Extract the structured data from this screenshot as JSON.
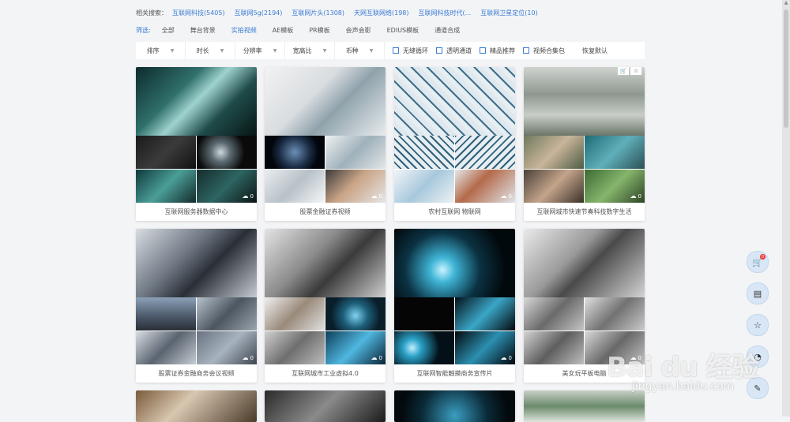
{
  "related": {
    "label": "相关搜索：",
    "items": [
      "互联网科技(5405)",
      "互联网5g(2194)",
      "互联网片头(1308)",
      "天网互联网络(198)",
      "互联网科技时代(...",
      "互联网卫星定位(10)"
    ]
  },
  "filter": {
    "label": "筛选:",
    "categories": [
      "全部",
      "舞台背景",
      "实拍视频",
      "AE模板",
      "PR模板",
      "会声会影",
      "EDIUS模板",
      "通道合成"
    ],
    "active_index": 2
  },
  "sortbar": {
    "dropdowns": [
      "排序",
      "时长",
      "分辨率",
      "宽高比",
      "币种"
    ],
    "checkboxes": [
      "无缝循环",
      "透明通道",
      "精品推荐",
      "视频合集包"
    ],
    "reset": "恢复默认"
  },
  "cards": [
    {
      "caption": "互联网服务器数据中心",
      "downloads": "0"
    },
    {
      "caption": "股票金融证券视频",
      "downloads": "0"
    },
    {
      "caption": "农村互联网 物联网",
      "downloads": "0"
    },
    {
      "caption": "互联网城市快速节奏科技数字生活",
      "downloads": "0"
    },
    {
      "caption": "股票证券金融商务会议视频",
      "downloads": "0"
    },
    {
      "caption": "互联网城市工业虚拟4.0",
      "downloads": "0"
    },
    {
      "caption": "互联网智能触摸商务宣传片",
      "downloads": "0"
    },
    {
      "caption": "美女玩平板电脑",
      "downloads": "0"
    }
  ],
  "floatbar": {
    "cart_badge": "0",
    "icons": [
      "cart-icon",
      "document-icon",
      "star-icon",
      "chat-icon",
      "edit-icon"
    ]
  },
  "watermark": {
    "logo": "Bai du 经验",
    "url": "jingyan.baidu.com"
  }
}
